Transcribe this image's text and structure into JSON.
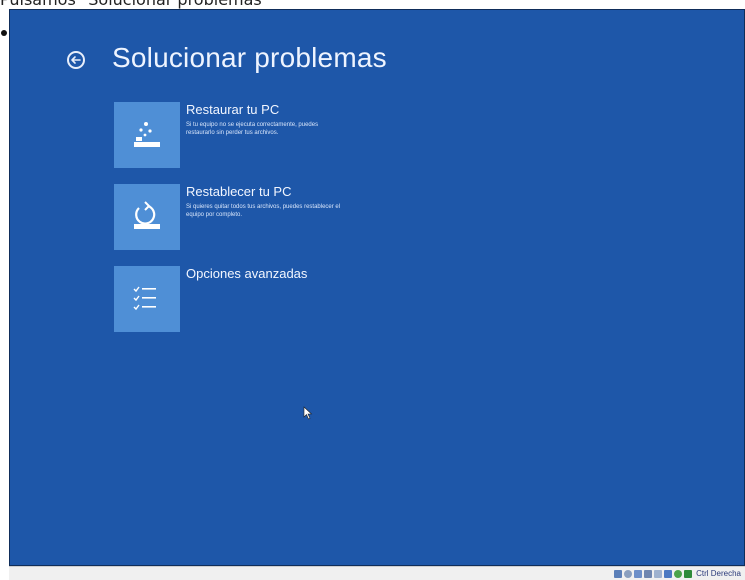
{
  "caption": "Pulsamos \"Solucionar problemas\"",
  "screen": {
    "title": "Solucionar problemas",
    "options": [
      {
        "title": "Restaurar tu PC",
        "description": "Si tu equipo no se ejecuta correctamente, puedes restaurarlo sin perder tus archivos.",
        "icon": "restore-icon"
      },
      {
        "title": "Restablecer tu PC",
        "description": "Si quieres quitar todos tus archivos, puedes restablecer el equipo por completo.",
        "icon": "reset-icon"
      },
      {
        "title": "Opciones avanzadas",
        "description": "",
        "icon": "checklist-icon"
      }
    ]
  },
  "statusbar": {
    "host_key": "Ctrl Derecha",
    "tray_icons": [
      "hard-disk-icon",
      "optical-drive-icon",
      "usb-icon",
      "shared-folder-icon",
      "display-icon",
      "network-icon",
      "mouse-integration-icon",
      "green-status-icon"
    ]
  },
  "colors": {
    "background": "#1e57a9",
    "tile": "#4f8fd6",
    "text": "#eef4ff"
  }
}
